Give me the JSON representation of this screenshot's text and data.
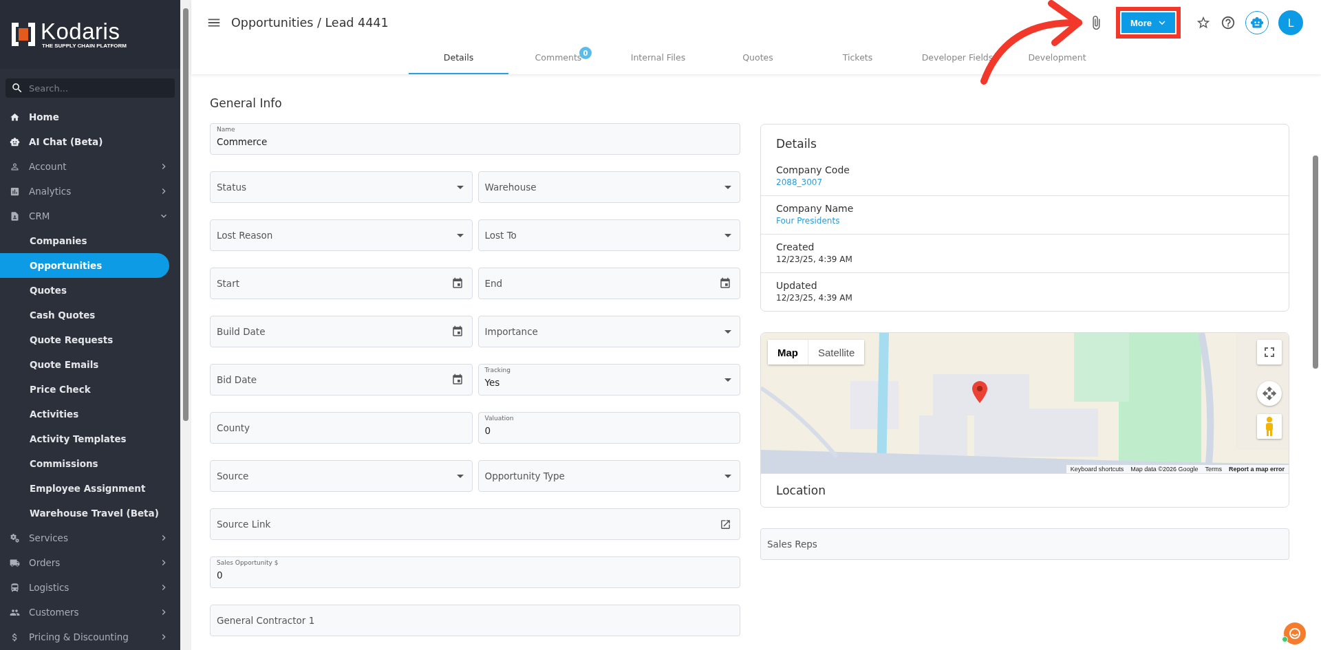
{
  "sidebar": {
    "logo": {
      "name": "Kodaris",
      "tagline": "THE SUPPLY CHAIN PLATFORM"
    },
    "search": {
      "placeholder": "Search..."
    },
    "items": [
      {
        "label": "Home",
        "kind": "link"
      },
      {
        "label": "AI Chat (Beta)",
        "kind": "link"
      },
      {
        "label": "Account",
        "kind": "group",
        "expanded": false
      },
      {
        "label": "Analytics",
        "kind": "group",
        "expanded": false
      },
      {
        "label": "CRM",
        "kind": "group",
        "expanded": true,
        "children": [
          {
            "label": "Companies",
            "selected": false
          },
          {
            "label": "Opportunities",
            "selected": true
          },
          {
            "label": "Quotes",
            "selected": false
          },
          {
            "label": "Cash Quotes",
            "selected": false
          },
          {
            "label": "Quote Requests",
            "selected": false
          },
          {
            "label": "Quote Emails",
            "selected": false
          },
          {
            "label": "Price Check",
            "selected": false
          },
          {
            "label": "Activities",
            "selected": false
          },
          {
            "label": "Activity Templates",
            "selected": false
          },
          {
            "label": "Commissions",
            "selected": false
          },
          {
            "label": "Employee Assignment",
            "selected": false
          },
          {
            "label": "Warehouse Travel (Beta)",
            "selected": false
          }
        ]
      },
      {
        "label": "Services",
        "kind": "group",
        "expanded": false
      },
      {
        "label": "Orders",
        "kind": "group",
        "expanded": false
      },
      {
        "label": "Logistics",
        "kind": "group",
        "expanded": false
      },
      {
        "label": "Customers",
        "kind": "group",
        "expanded": false
      },
      {
        "label": "Pricing & Discounting",
        "kind": "group",
        "expanded": false
      }
    ]
  },
  "header": {
    "breadcrumb": "Opportunities / Lead 4441",
    "more_button": "More",
    "avatar": "L"
  },
  "tabs": [
    {
      "label": "Details",
      "selected": true
    },
    {
      "label": "Comments",
      "badge": "0",
      "selected": false
    },
    {
      "label": "Internal Files",
      "selected": false
    },
    {
      "label": "Quotes",
      "selected": false
    },
    {
      "label": "Tickets",
      "selected": false
    },
    {
      "label": "Developer Fields",
      "selected": false
    },
    {
      "label": "Development",
      "selected": false
    }
  ],
  "general_info": {
    "title": "General Info",
    "rows": [
      [
        {
          "kind": "text",
          "label": "Name",
          "value": "Commerce"
        }
      ],
      [
        {
          "kind": "select",
          "placeholder": "Status"
        },
        {
          "kind": "select",
          "placeholder": "Warehouse"
        }
      ],
      [
        {
          "kind": "select",
          "placeholder": "Lost Reason"
        },
        {
          "kind": "select",
          "placeholder": "Lost To"
        }
      ],
      [
        {
          "kind": "date",
          "placeholder": "Start"
        },
        {
          "kind": "date",
          "placeholder": "End"
        }
      ],
      [
        {
          "kind": "date",
          "placeholder": "Build Date"
        },
        {
          "kind": "select",
          "placeholder": "Importance"
        }
      ],
      [
        {
          "kind": "date",
          "placeholder": "Bid Date"
        },
        {
          "kind": "select",
          "label": "Tracking",
          "value": "Yes"
        }
      ],
      [
        {
          "kind": "text",
          "placeholder": "County"
        },
        {
          "kind": "text",
          "label": "Valuation",
          "value": "0"
        }
      ],
      [
        {
          "kind": "select",
          "placeholder": "Source"
        },
        {
          "kind": "select",
          "placeholder": "Opportunity Type"
        }
      ],
      [
        {
          "kind": "link",
          "placeholder": "Source Link"
        }
      ],
      [
        {
          "kind": "text",
          "label": "Sales Opportunity $",
          "value": "0"
        }
      ],
      [
        {
          "kind": "text",
          "placeholder": "General Contractor 1"
        }
      ]
    ]
  },
  "details_card": {
    "title": "Details",
    "rows": [
      {
        "label": "Company Code",
        "value": "2088_3007",
        "kind": "link"
      },
      {
        "label": "Company Name",
        "value": "Four Presidents",
        "kind": "link"
      },
      {
        "label": "Created",
        "value": "12/23/25, 4:39 AM",
        "kind": "text"
      },
      {
        "label": "Updated",
        "value": "12/23/25, 4:39 AM",
        "kind": "text"
      }
    ]
  },
  "map": {
    "kind": "picture",
    "map_types": [
      {
        "label": "Map",
        "selected": true
      },
      {
        "label": "Satellite",
        "selected": false
      }
    ],
    "attribution": [
      "Keyboard shortcuts",
      "Map data ©2026 Google",
      "Terms",
      "Report a map error"
    ],
    "caption": "Location"
  },
  "sales_reps": {
    "placeholder": "Sales Reps"
  }
}
